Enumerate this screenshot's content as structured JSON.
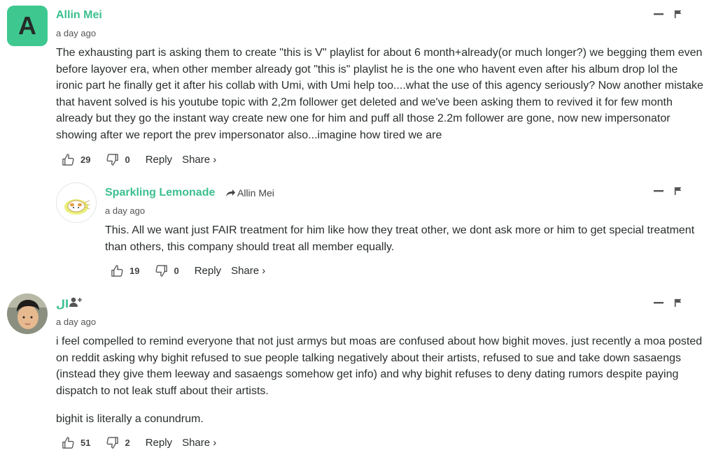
{
  "comments": [
    {
      "avatar_letter": "A",
      "author": "Allin Mei",
      "time": "a day ago",
      "body": "The exhausting part is asking them to create \"this is V\" playlist for about 6 month+already(or much longer?) we begging them even before layover era, when other member already got \"this is\" playlist he is the one who havent even after his album drop lol the ironic part he finally get it after his collab with Umi, with Umi help too....what the use of this agency seriously? Now another mistake that havent solved is his youtube topic with 2,2m follower get deleted and we've been asking them to revived it for few month already but they go the instant way create new one for him and puff all those 2.2m follower are gone, now new impersonator showing after we report the prev impersonator also...imagine how tired we are",
      "upvotes": "29",
      "downvotes": "0",
      "reply_label": "Reply",
      "share_label": "Share ›"
    },
    {
      "author": "Sparkling Lemonade",
      "reply_to": "Allin Mei",
      "time": "a day ago",
      "body": "This. All we want just FAIR treatment for him like how they treat other, we dont ask more or him to get special treatment than others, this company should treat all member equally.",
      "upvotes": "19",
      "downvotes": "0",
      "reply_label": "Reply",
      "share_label": "Share ›"
    },
    {
      "author": "ال",
      "time": "a day ago",
      "body_p1": "i feel compelled to remind everyone that not just armys but moas are confused about how bighit moves. just recently a moa posted on reddit asking why bighit refused to sue people talking negatively about their artists, refused to sue and take down sasaengs (instead they give them leeway and sasaengs somehow get info) and why bighit refuses to deny dating rumors despite paying dispatch to not leak stuff about their artists.",
      "body_p2": "bighit is literally a conundrum.",
      "upvotes": "51",
      "downvotes": "2",
      "reply_label": "Reply",
      "share_label": "Share ›"
    }
  ]
}
